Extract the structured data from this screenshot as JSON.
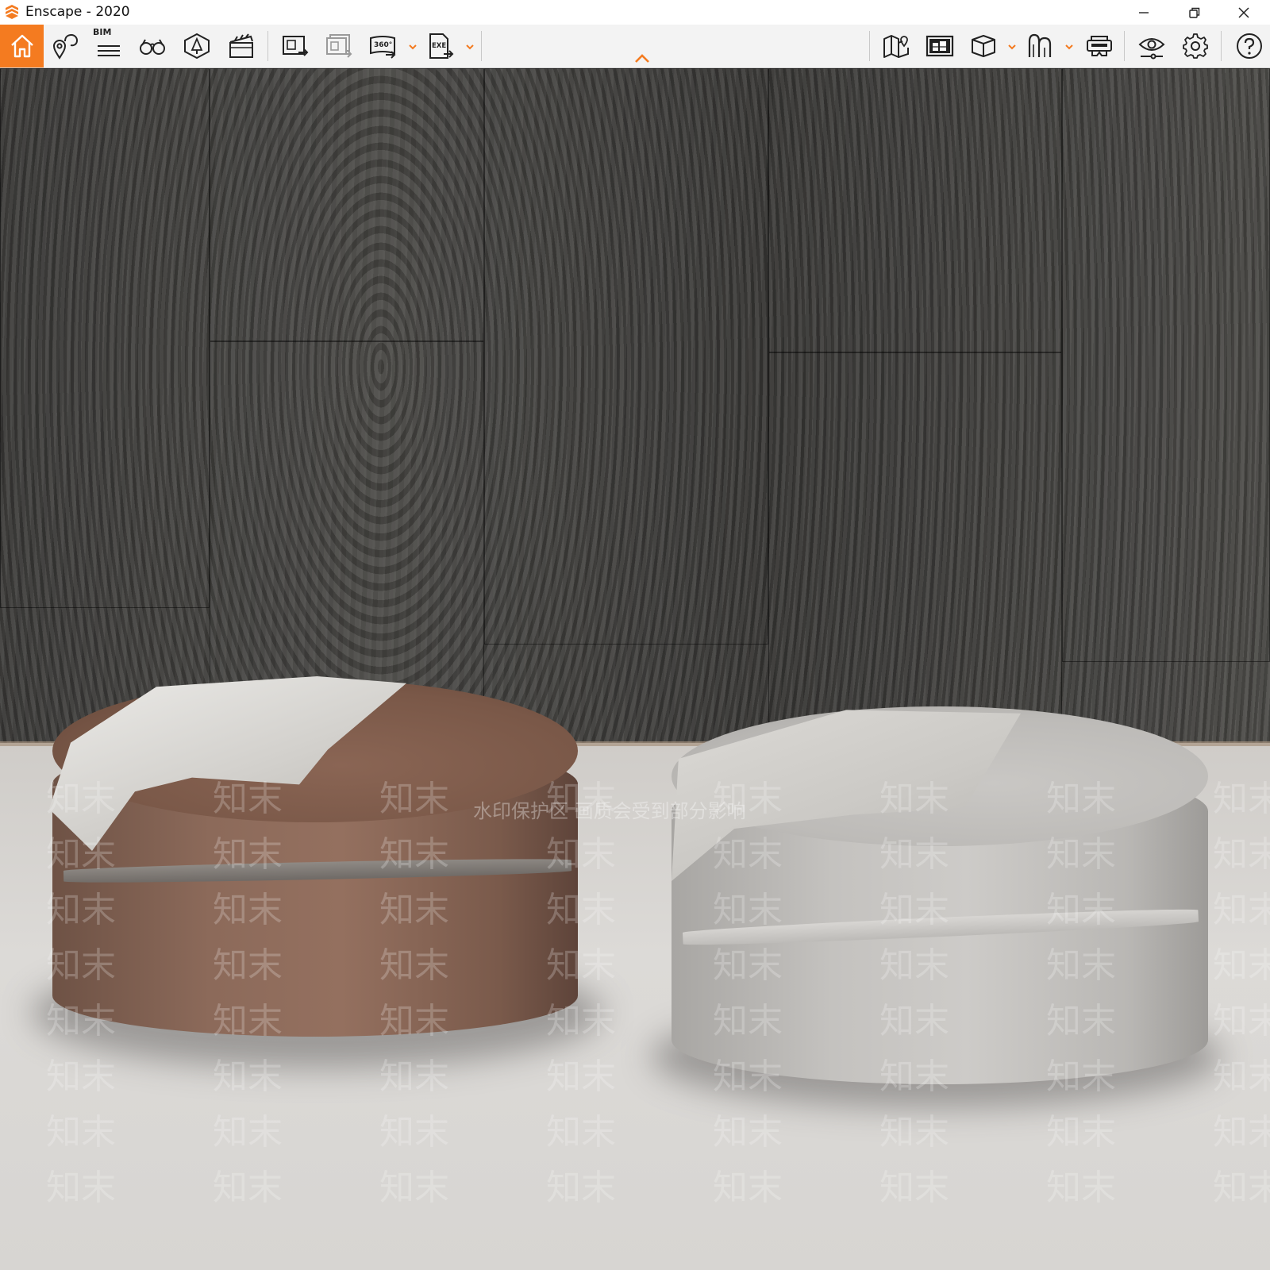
{
  "window": {
    "title": "Enscape - 2020"
  },
  "toolbar": {
    "bim_label": "BIM",
    "panorama_label": "360°",
    "exe_label": "EXE",
    "accent_color": "#f47b20"
  },
  "icons": [
    "home-icon",
    "view-management-icon",
    "bim-icon",
    "binoculars-icon",
    "light-view-icon",
    "video-editor-icon",
    "screenshot-icon",
    "batch-render-icon",
    "panorama-icon",
    "export-exe-icon",
    "map-icon",
    "asset-library-icon",
    "cube-icon",
    "site-context-icon",
    "vr-headset-icon",
    "visual-settings-icon",
    "settings-icon",
    "help-icon"
  ],
  "viewport": {
    "watermark_text": "知末",
    "watermark_note": "水印保护区  画质会受到部分影响"
  }
}
